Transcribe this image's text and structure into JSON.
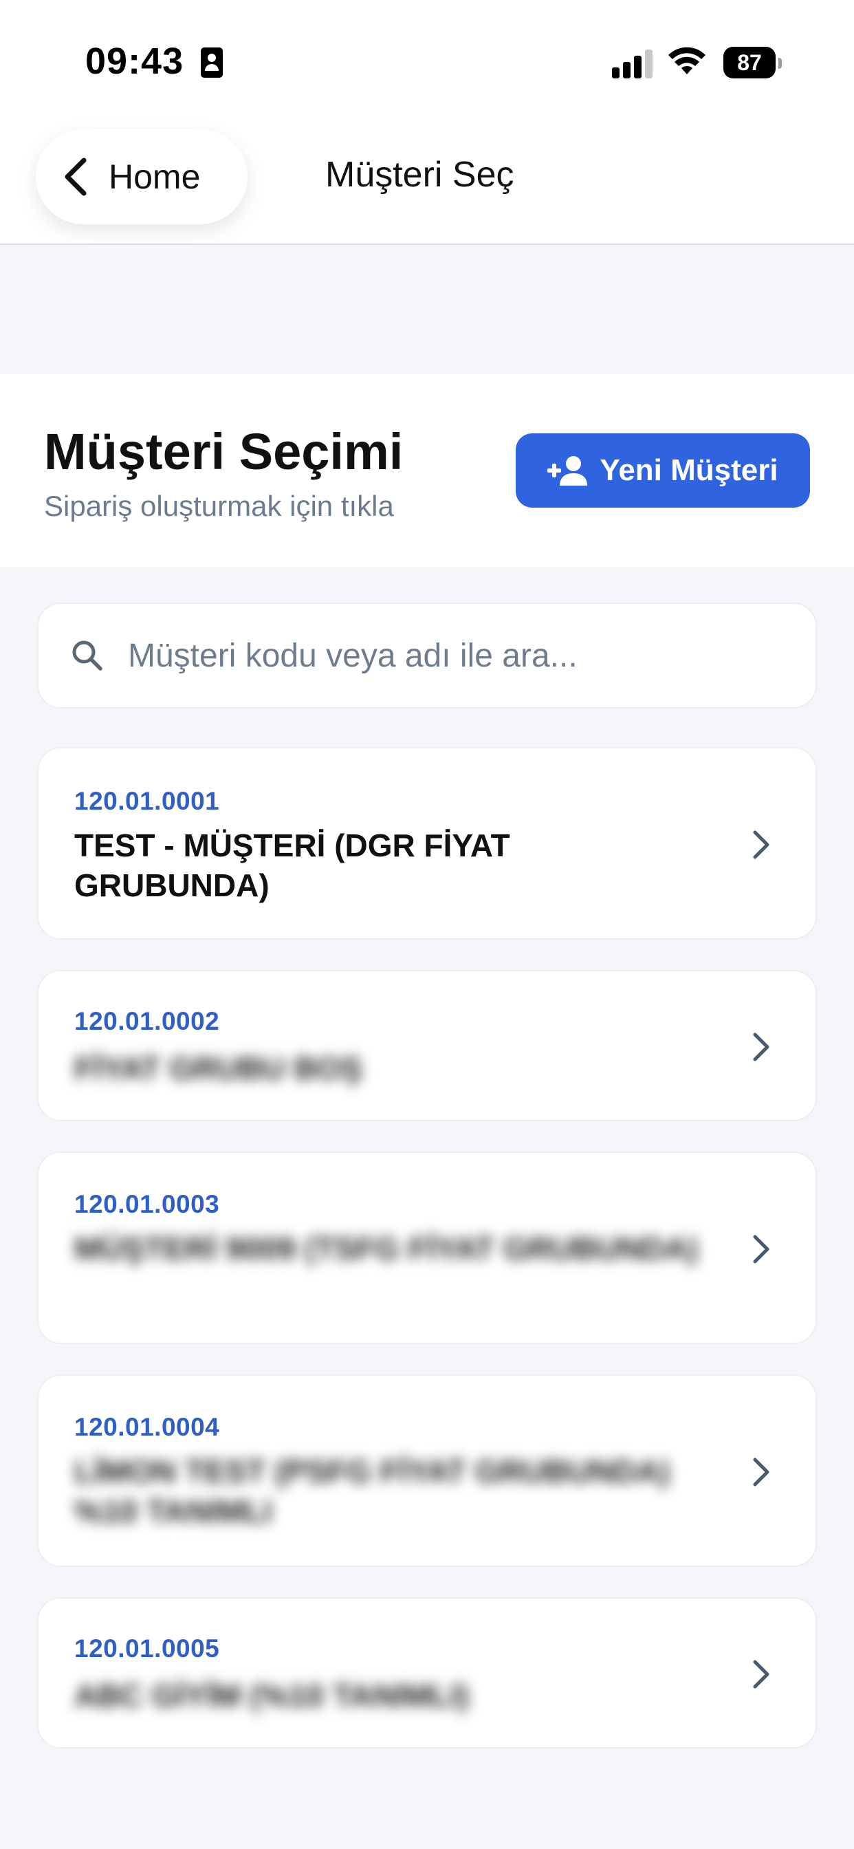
{
  "status_bar": {
    "time": "09:43",
    "battery": "87"
  },
  "nav": {
    "back_label": "Home",
    "title": "Müşteri Seç"
  },
  "header": {
    "title": "Müşteri Seçimi",
    "subtitle": "Sipariş oluşturmak için tıkla",
    "new_customer_label": "Yeni Müşteri"
  },
  "search": {
    "placeholder": "Müşteri kodu veya adı ile ara...",
    "value": ""
  },
  "customers": [
    {
      "code": "120.01.0001",
      "name": "TEST - MÜŞTERİ (DGR FİYAT GRUBUNDA)"
    },
    {
      "code": "120.01.0002",
      "name": "FİYAT GRUBU BOŞ"
    },
    {
      "code": "120.01.0003",
      "name": "MÜŞTERİ 9009 (TSFG FİYAT GRUBUNDA)"
    },
    {
      "code": "120.01.0004",
      "name": "LİMON TEST (PSFG FİYAT GRUBUNDA) %10 TANIMLI"
    },
    {
      "code": "120.01.0005",
      "name": "ABC GİYİM (%10 TANIMLI)"
    }
  ],
  "colors": {
    "accent": "#2f63e0",
    "code_text": "#2f5fc4",
    "background": "#f4f6f9"
  }
}
